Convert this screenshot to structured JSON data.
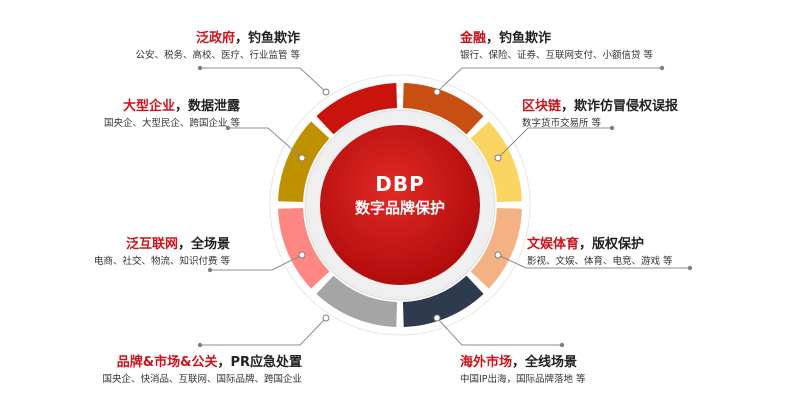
{
  "center": {
    "line1": "DBP",
    "line2": "数字品牌保护"
  },
  "segments": [
    {
      "id": "gov",
      "color": "#c9140e",
      "highlight": "泛政府",
      "rest": "，钓鱼欺诈",
      "sub": "公安、税务、高校、医疗、行业监管  等"
    },
    {
      "id": "finance",
      "color": "#c84f12",
      "highlight": "金融",
      "rest": "，钓鱼欺诈",
      "sub": "银行、保险、证券、互联网支付、小额信贷 等"
    },
    {
      "id": "blockchain",
      "color": "#fad563",
      "highlight": "区块链",
      "rest": "，欺诈仿冒侵权误报",
      "sub": "数字货币交易所 等"
    },
    {
      "id": "entertainment",
      "color": "#f4b183",
      "highlight": "文娱体育",
      "rest": "，版权保护",
      "sub": "影视、文娱、体育、电竞、游戏 等"
    },
    {
      "id": "overseas",
      "color": "#2e3a4e",
      "highlight": "海外市场",
      "rest": "，全线场景",
      "sub": "中国IP出海，国际品牌落地 等"
    },
    {
      "id": "brand",
      "color": "#a5a5a5",
      "highlight": "品牌&市场&公关",
      "rest": "，PR应急处置",
      "sub": "国央企、快消品、互联网、国际品牌、跨国企业"
    },
    {
      "id": "internet",
      "color": "#ff8783",
      "highlight": "泛互联网",
      "rest": "，全场景",
      "sub": "电商、社交、物流、知识付费 等"
    },
    {
      "id": "enterprise",
      "color": "#bf9000",
      "highlight": "大型企业",
      "rest": "，数据泄露",
      "sub": "国央企、大型民企、跨国企业  等"
    }
  ]
}
